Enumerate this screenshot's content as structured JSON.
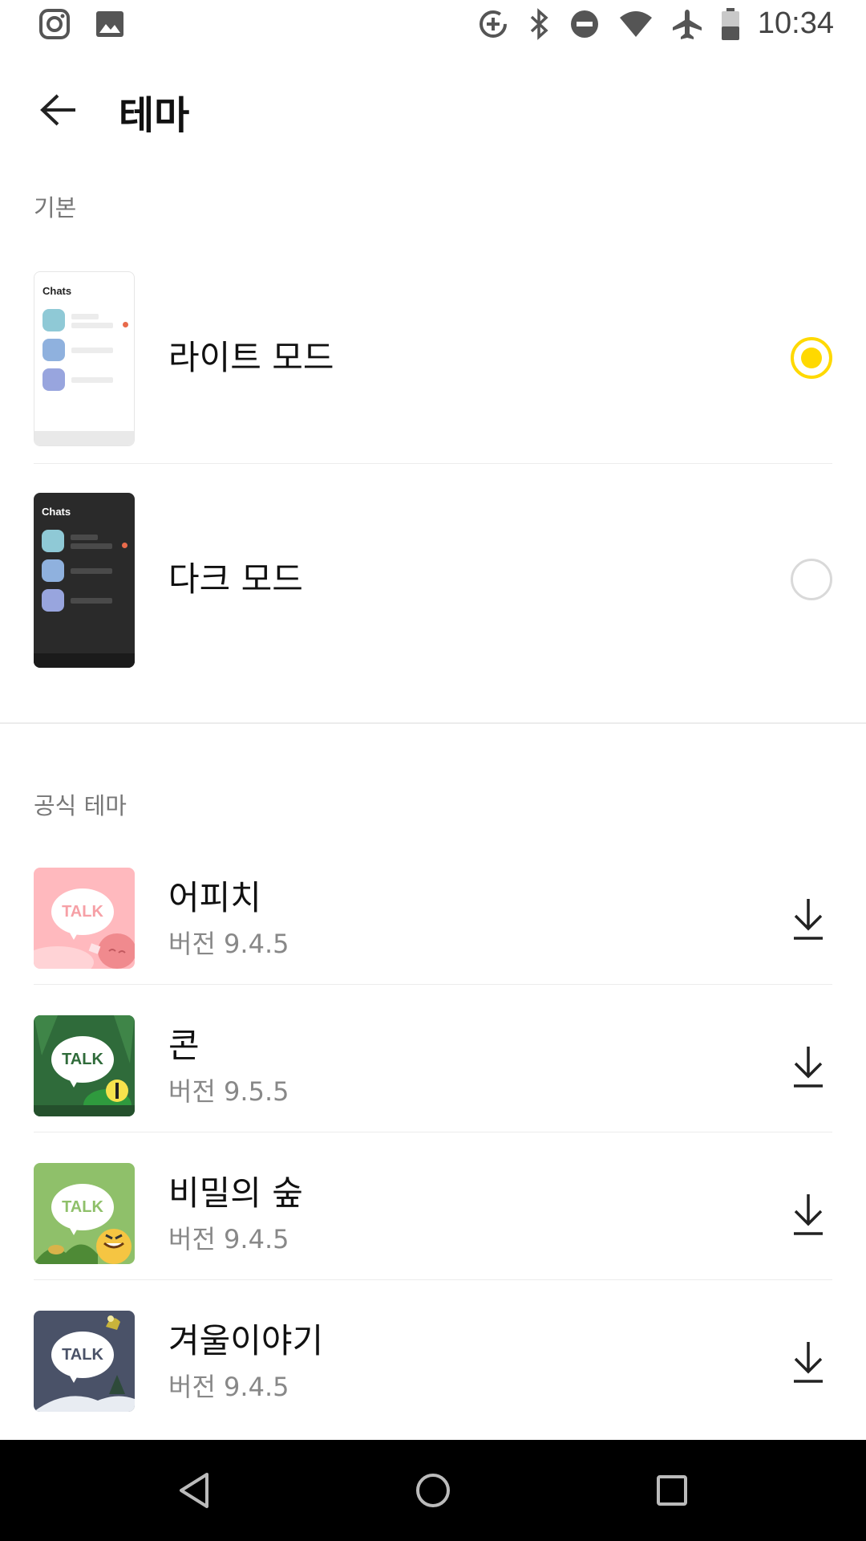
{
  "status_bar": {
    "left_icons": [
      "instagram-icon",
      "image-icon"
    ],
    "right_icons": [
      "data-saver-icon",
      "bluetooth-icon",
      "do-not-disturb-icon",
      "wifi-icon",
      "airplane-mode-icon",
      "battery-icon"
    ],
    "time": "10:34"
  },
  "header": {
    "title": "테마",
    "back_icon": "arrow-left-icon"
  },
  "basic_section": {
    "label": "기본",
    "themes": [
      {
        "label": "라이트 모드",
        "preview_title": "Chats",
        "selected": true
      },
      {
        "label": "다크 모드",
        "preview_title": "Chats",
        "selected": false
      }
    ]
  },
  "official_section": {
    "label": "공식 테마",
    "themes": [
      {
        "name": "어피치",
        "version": "버전 9.4.5",
        "thumb_text": "TALK",
        "thumb_color": "#ffb9be"
      },
      {
        "name": "콘",
        "version": "버전 9.5.5",
        "thumb_text": "TALK",
        "thumb_color": "#2f6b3a"
      },
      {
        "name": "비밀의 숲",
        "version": "버전 9.4.5",
        "thumb_text": "TALK",
        "thumb_color": "#8fc06a"
      },
      {
        "name": "겨울이야기",
        "version": "버전 9.4.5",
        "thumb_text": "TALK",
        "thumb_color": "#4a5268"
      }
    ]
  },
  "colors": {
    "accent": "#ffd900",
    "divider": "#ececec",
    "nav_bar": "#000000"
  },
  "nav_bar": {
    "buttons": [
      "back-triangle-icon",
      "home-circle-icon",
      "recents-square-icon"
    ]
  }
}
